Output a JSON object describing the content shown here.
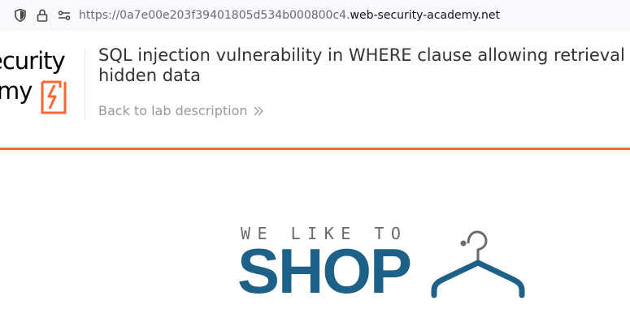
{
  "browser": {
    "url_prefix": "https://0a7e00e203f39401805d534b000800c4.",
    "url_domain": "web-security-academy.net",
    "icons": [
      "shield-icon",
      "lock-icon",
      "permissions-icon"
    ]
  },
  "header": {
    "logo_line1": "ecurity",
    "logo_line2": "my",
    "title": "SQL injection vulnerability in WHERE clause allowing retrieval of hidden data",
    "back_link": "Back to lab description",
    "accent_color": "#ff6633"
  },
  "shop": {
    "tagline": "WE LIKE TO",
    "brand": "SHOP",
    "brand_color": "#1d6189"
  }
}
